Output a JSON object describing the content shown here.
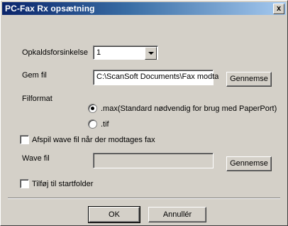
{
  "window": {
    "title": "PC-Fax Rx opsætning",
    "close_glyph": "x"
  },
  "dial_delay": {
    "label": "Opkaldsforsinkelse",
    "value": "1"
  },
  "save_file": {
    "label": "Gem fil",
    "value": "C:\\ScanSoft Documents\\Fax modta",
    "browse_label": "Gennemse"
  },
  "file_format": {
    "label": "Filformat",
    "options": [
      {
        "label": ".max(Standard nødvendig for brug med PaperPort)",
        "checked": true
      },
      {
        "label": ".tif",
        "checked": false
      }
    ]
  },
  "play_wave": {
    "label": "Afspil wave fil når der modtages fax",
    "checked": false
  },
  "wave_file": {
    "label": "Wave fil",
    "value": "",
    "browse_label": "Gennemse"
  },
  "startup": {
    "label": "Tilføj til startfolder",
    "checked": false
  },
  "footer": {
    "ok_label": "OK",
    "cancel_label": "Annullér"
  }
}
